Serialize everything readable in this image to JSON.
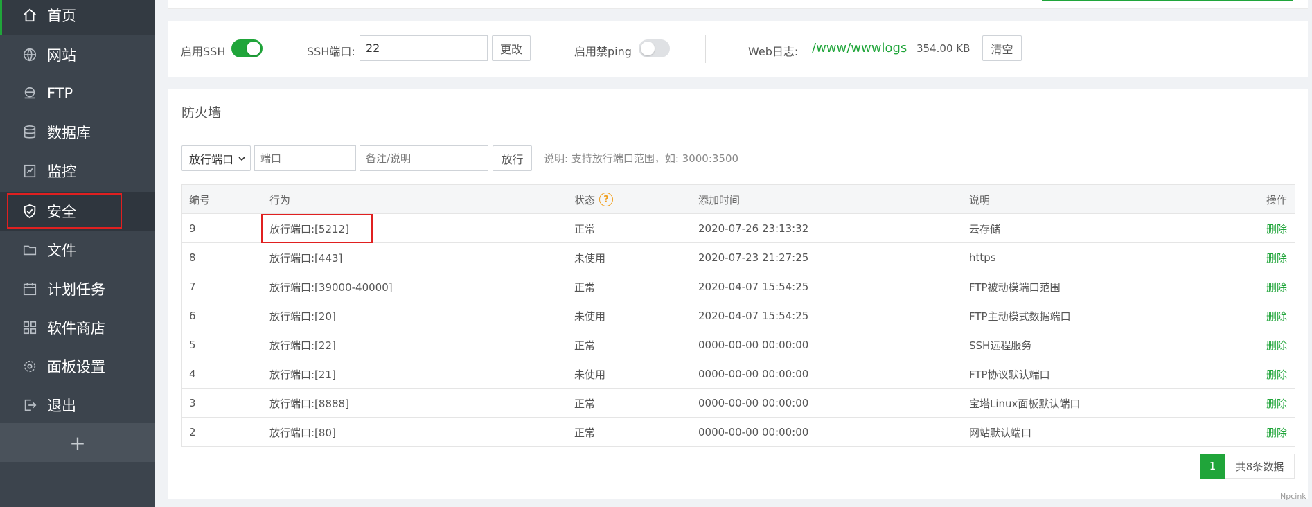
{
  "sidebar": {
    "items": [
      {
        "label": "首页",
        "icon": "home-icon"
      },
      {
        "label": "网站",
        "icon": "globe-icon"
      },
      {
        "label": "FTP",
        "icon": "ftp-icon"
      },
      {
        "label": "数据库",
        "icon": "database-icon"
      },
      {
        "label": "监控",
        "icon": "monitor-icon"
      },
      {
        "label": "安全",
        "icon": "shield-icon"
      },
      {
        "label": "文件",
        "icon": "folder-icon"
      },
      {
        "label": "计划任务",
        "icon": "calendar-icon"
      },
      {
        "label": "软件商店",
        "icon": "grid-icon"
      },
      {
        "label": "面板设置",
        "icon": "gear-icon"
      },
      {
        "label": "退出",
        "icon": "logout-icon"
      }
    ],
    "add_label": "+"
  },
  "ssh": {
    "enable_label": "启用SSH",
    "enabled": true,
    "port_label": "SSH端口:",
    "port_value": "22",
    "change_label": "更改",
    "ping_label": "启用禁ping",
    "ping_enabled": false,
    "weblog_label": "Web日志:",
    "weblog_path": "/www/wwwlogs",
    "weblog_size": "354.00 KB",
    "clear_label": "清空"
  },
  "firewall": {
    "title": "防火墙",
    "select_value": "放行端口",
    "port_placeholder": "端口",
    "note_placeholder": "备注/说明",
    "allow_label": "放行",
    "hint": "说明: 支持放行端口范围，如: 3000:3500",
    "columns": {
      "id": "编号",
      "action": "行为",
      "status": "状态",
      "time": "添加时间",
      "note": "说明",
      "op": "操作"
    },
    "rows": [
      {
        "id": "9",
        "action": "放行端口:[5212]",
        "status": "正常",
        "time": "2020-07-26 23:13:32",
        "note": "云存储",
        "op": "删除"
      },
      {
        "id": "8",
        "action": "放行端口:[443]",
        "status": "未使用",
        "time": "2020-07-23 21:27:25",
        "note": "https",
        "op": "删除"
      },
      {
        "id": "7",
        "action": "放行端口:[39000-40000]",
        "status": "正常",
        "time": "2020-04-07 15:54:25",
        "note": "FTP被动模端口范围",
        "op": "删除"
      },
      {
        "id": "6",
        "action": "放行端口:[20]",
        "status": "未使用",
        "time": "2020-04-07 15:54:25",
        "note": "FTP主动模式数据端口",
        "op": "删除"
      },
      {
        "id": "5",
        "action": "放行端口:[22]",
        "status": "正常",
        "time": "0000-00-00 00:00:00",
        "note": "SSH远程服务",
        "op": "删除"
      },
      {
        "id": "4",
        "action": "放行端口:[21]",
        "status": "未使用",
        "time": "0000-00-00 00:00:00",
        "note": "FTP协议默认端口",
        "op": "删除"
      },
      {
        "id": "3",
        "action": "放行端口:[8888]",
        "status": "正常",
        "time": "0000-00-00 00:00:00",
        "note": "宝塔Linux面板默认端口",
        "op": "删除"
      },
      {
        "id": "2",
        "action": "放行端口:[80]",
        "status": "正常",
        "time": "0000-00-00 00:00:00",
        "note": "网站默认端口",
        "op": "删除"
      }
    ],
    "pager": {
      "current": "1",
      "total_text": "共8条数据"
    }
  },
  "watermark": "Npcink",
  "colors": {
    "accent": "#20a53a",
    "sidebar": "#3c444d",
    "highlight": "#e02020"
  }
}
